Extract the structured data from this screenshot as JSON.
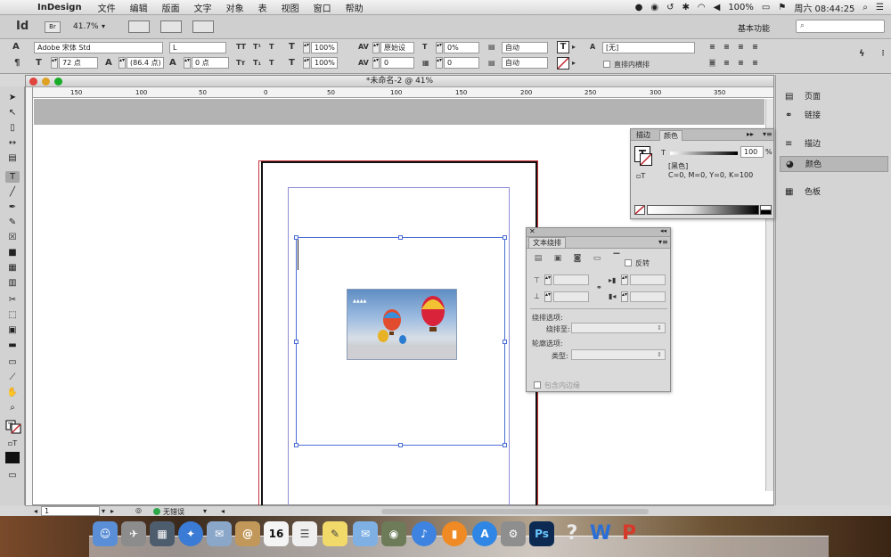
{
  "menubar": {
    "app_name": "InDesign",
    "items": [
      "文件",
      "编辑",
      "版面",
      "文字",
      "对象",
      "表",
      "视图",
      "窗口",
      "帮助"
    ],
    "battery": "100%",
    "clock": "周六 08:44:25"
  },
  "appbar": {
    "logo": "Id",
    "bridge": "Br",
    "zoom": "41.7%",
    "workspace": "基本功能",
    "search_placeholder": ""
  },
  "control": {
    "font_family": "Adobe 宋体 Std",
    "font_style": "L",
    "font_size": "72 点",
    "leading": "(86.4 点)",
    "baseline": "0 点",
    "h_scale": "100%",
    "v_scale": "100%",
    "kerning": "原始设",
    "tracking": "0",
    "tsume": "0%",
    "grid": "0",
    "auto1": "自动",
    "auto2": "自动",
    "char_style": "[无]",
    "direct_horizontal": "直排内横排"
  },
  "document": {
    "title": "*未命名-2 @ 41%",
    "ruler_labels": [
      "150",
      "100",
      "50",
      "0",
      "50",
      "100",
      "150",
      "200",
      "250",
      "300",
      "350"
    ],
    "page_number": "1",
    "errors": "无错误"
  },
  "dock_panels": [
    {
      "label": "页面",
      "icon": "pages-icon"
    },
    {
      "label": "链接",
      "icon": "links-icon"
    },
    {
      "label": "描边",
      "icon": "stroke-icon"
    },
    {
      "label": "颜色",
      "icon": "color-icon"
    },
    {
      "label": "色板",
      "icon": "swatches-icon"
    }
  ],
  "color_panel": {
    "tab_stroke": "描边",
    "tab_color": "颜色",
    "tint_label": "T",
    "tint_value": "100",
    "tint_unit": "%",
    "swatch_name": "[黑色]",
    "cmyk": "C=0, M=0, Y=0, K=100"
  },
  "wrap_panel": {
    "title": "文本绕排",
    "invert": "反转",
    "wrap_options": "绕排选项:",
    "wrap_to": "绕排至:",
    "contour_options": "轮廓选项:",
    "type": "类型:",
    "include_inside": "包含内边缘"
  },
  "colors": {
    "page_bleed": "#c7323a",
    "margin": "#8c8cd8",
    "frame": "#4a6dd4",
    "no_error": "#2fa84a"
  }
}
